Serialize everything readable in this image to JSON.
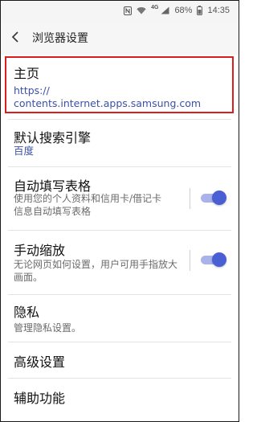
{
  "status_bar": {
    "network": "4G",
    "battery": "68%",
    "time": "14:35"
  },
  "header": {
    "title": "浏览器设置"
  },
  "settings": {
    "homepage": {
      "title": "主页",
      "value": "https://\ncontents.internet.apps.samsung.com"
    },
    "search_engine": {
      "title": "默认搜索引擎",
      "value": "百度"
    },
    "autofill": {
      "title": "自动填写表格",
      "description": "使用您的个人资料和信用卡/借记卡\n信息自动填写表格",
      "enabled": true
    },
    "manual_zoom": {
      "title": "手动缩放",
      "description": "无论网页如何设置，用户可用手指放大\n画面。",
      "enabled": true
    },
    "privacy": {
      "title": "隐私",
      "description": "管理隐私设置。"
    },
    "advanced": {
      "title": "高级设置"
    },
    "accessibility": {
      "title": "辅助功能"
    }
  },
  "colors": {
    "accent": "#4b5fd4",
    "highlight_border": "#d81e1e",
    "link_text": "#3b50a7"
  }
}
